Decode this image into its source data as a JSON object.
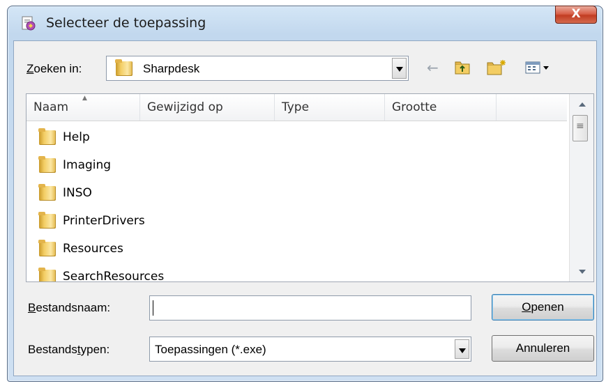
{
  "window": {
    "title": "Selecteer de toepassing",
    "close_glyph": "X"
  },
  "toolbar": {
    "look_in_label_first": "Z",
    "look_in_label_rest": "oeken in:",
    "look_in_value": "Sharpdesk",
    "icons": [
      "back-arrow-icon",
      "up-folder-icon",
      "new-folder-icon",
      "view-menu-icon"
    ]
  },
  "list": {
    "columns": [
      "Naam",
      "Gewijzigd op",
      "Type",
      "Grootte"
    ],
    "items": [
      {
        "name": "Help"
      },
      {
        "name": "Imaging"
      },
      {
        "name": "INSO"
      },
      {
        "name": "PrinterDrivers"
      },
      {
        "name": "Resources"
      },
      {
        "name": "SearchResources"
      }
    ]
  },
  "filename": {
    "label_first": "B",
    "label_rest": "estandsnaam:",
    "value": ""
  },
  "filetype": {
    "label_pre": "Bestands",
    "label_accel": "t",
    "label_post": "ypen:",
    "value": "Toepassingen (*.exe)"
  },
  "buttons": {
    "open_first": "O",
    "open_rest": "penen",
    "cancel": "Annuleren"
  }
}
